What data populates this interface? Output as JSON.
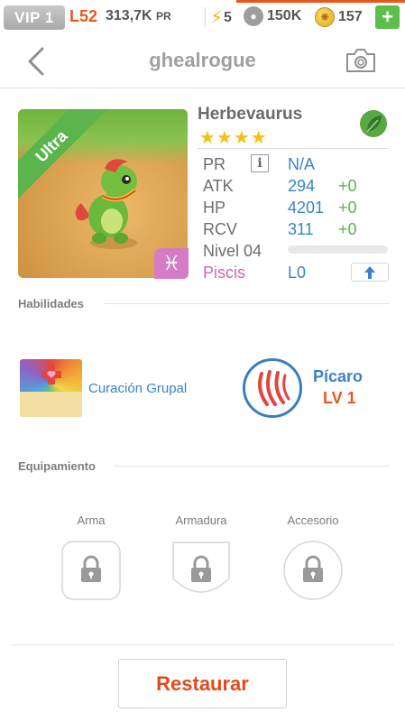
{
  "status_bar": {
    "vip": "VIP 1",
    "level": "L52",
    "pr": "313,7K",
    "pr_unit": "PR",
    "energy": "5",
    "friend_points": "150K",
    "coins": "157",
    "add_label": "+"
  },
  "header": {
    "title": "ghealrogue"
  },
  "monster": {
    "rarity": "Ultra",
    "name": "Herbevaurus",
    "stars": "★★★★",
    "element_icon": "leaf-icon",
    "zodiac_symbol": "♓",
    "stats": {
      "pr_label": "PR",
      "pr_info": "i",
      "pr_value": "N/A",
      "atk_label": "ATK",
      "atk_value": "294",
      "atk_bonus": "+0",
      "hp_label": "HP",
      "hp_value": "4201",
      "hp_bonus": "+0",
      "rcv_label": "RCV",
      "rcv_value": "311",
      "rcv_bonus": "+0",
      "level_label": "Nivel 04",
      "level_progress": 0,
      "zodiac_label": "Piscis",
      "zodiac_level": "L0"
    }
  },
  "skills": {
    "title": "Habilidades",
    "skill_name": "Curación Grupal",
    "role_name": "Pícaro",
    "role_level": "LV 1"
  },
  "equipment": {
    "title": "Equipamiento",
    "slots": [
      "Arma",
      "Armadura",
      "Accesorio"
    ]
  },
  "footer": {
    "restore_label": "Restaurar"
  },
  "colors": {
    "accent_orange": "#e45a1f",
    "stat_blue": "#3b83c5",
    "bonus_green": "#56b946",
    "pisces_pink": "#cb67b6"
  }
}
